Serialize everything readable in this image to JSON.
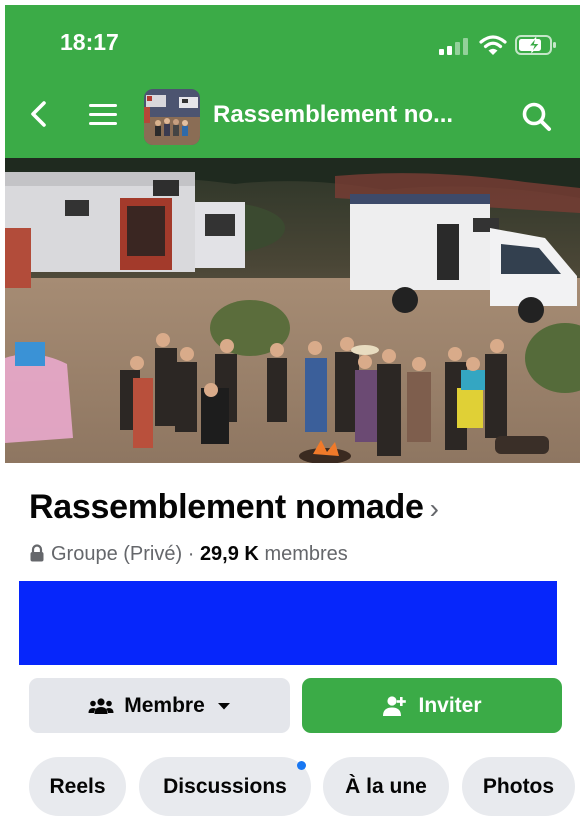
{
  "status_bar": {
    "time": "18:17"
  },
  "header": {
    "title": "Rassemblement nomade",
    "title_display": "Rassemblement no..."
  },
  "group": {
    "name": "Rassemblement nomade",
    "privacy": "Groupe (Privé)",
    "separator": " · ",
    "member_count": "29,9 K",
    "member_label": "membres"
  },
  "colors": {
    "brand_green": "#3bab47",
    "banner_blue": "#0626fb",
    "chip_bg": "#e8eaee",
    "notification_dot": "#1877f2"
  },
  "actions": {
    "member_label": "Membre",
    "invite_label": "Inviter"
  },
  "tabs": [
    {
      "label": "Reels",
      "has_notification": false
    },
    {
      "label": "Discussions",
      "has_notification": true
    },
    {
      "label": "À la une",
      "has_notification": false
    },
    {
      "label": "Photos",
      "has_notification": false
    }
  ],
  "icons": [
    "back-arrow-icon",
    "menu-icon",
    "search-icon",
    "lock-icon",
    "members-icon",
    "caret-down-icon",
    "add-person-icon",
    "chevron-right-icon"
  ]
}
